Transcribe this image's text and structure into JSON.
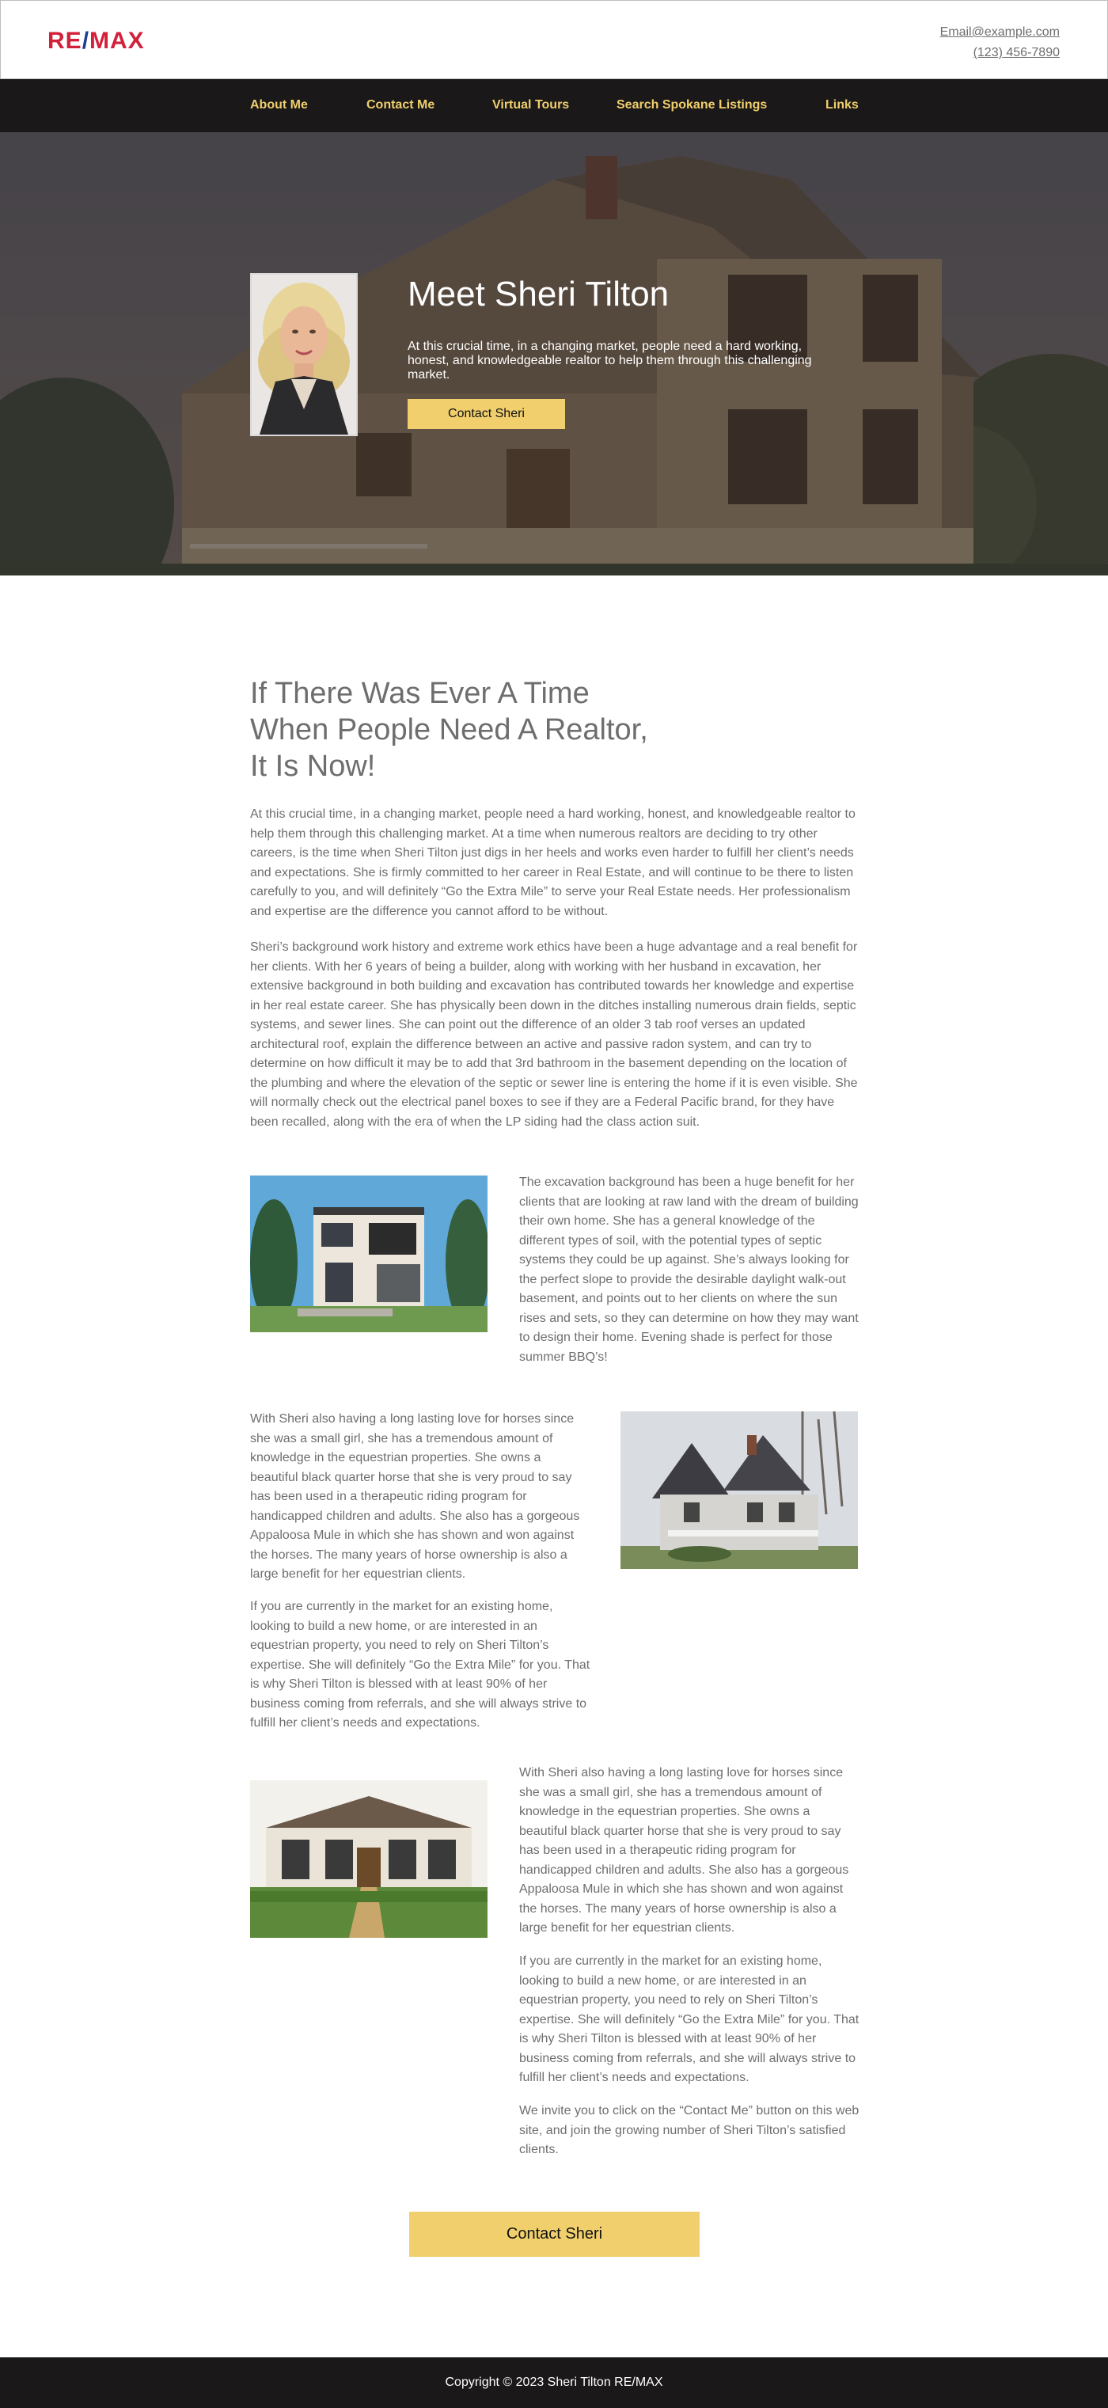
{
  "header": {
    "logo": {
      "re": "RE",
      "slash": "/",
      "max": "MAX"
    },
    "email": "Email@example.com",
    "phone": "(123) 456-7890"
  },
  "nav": {
    "items": [
      "About Me",
      "Contact Me",
      "Virtual Tours",
      "Search Spokane Listings",
      "Links"
    ]
  },
  "hero": {
    "title": "Meet Sheri Tilton",
    "text": "At this crucial time, in a changing market, people need a hard working, honest, and knowledgeable realtor to help them through this challenging market.",
    "button": "Contact Sheri"
  },
  "main": {
    "headline": [
      "If There Was Ever A Time",
      "When People Need A Realtor,",
      "It Is Now!"
    ],
    "intro1": "At this crucial time, in a changing market, people need a hard working, honest, and knowledgeable realtor to help them through this challenging market.  At a time when numerous realtors are deciding to try other careers, is the time when Sheri Tilton just digs in her heels and works even harder to fulfill her client’s needs and expectations.  She is firmly committed to her career in Real Estate, and will continue to be there to listen carefully to you, and will definitely “Go the Extra Mile” to serve your Real Estate needs.  Her professionalism and expertise are the difference you cannot afford to be without.",
    "intro2": "Sheri’s background work history and extreme work ethics have been a huge advantage and a real benefit for her clients.  With her 6 years of being a builder, along with working with her husband in excavation, her extensive background in both building and excavation has contributed towards her knowledge and expertise in her real estate career.  She has physically been down in the ditches installing numerous drain fields, septic systems, and sewer lines.  She can point out the difference of an older 3 tab roof verses an updated architectural roof, explain the difference between an active and passive radon system, and can try to determine on how difficult it may be to add that 3rd bathroom in the basement depending on the location of the plumbing and where the elevation of the septic or sewer line is entering the home if it is even visible.  She  will normally  check out the electrical panel boxes to see if they are a Federal Pacific brand, for they have been recalled, along with the era of when the LP siding had the class action suit.",
    "section1": "The excavation background has been a huge benefit for her clients that are looking at raw land with the dream of building their own home.  She has a general knowledge of the different types of soil, with the potential types of septic systems they could be up against.  She’s always looking for the perfect slope to provide the desirable daylight walk-out basement, and points out to her clients on where the sun rises and sets, so they can determine on how they may want to design their home.  Evening shade is perfect for those summer BBQ’s!",
    "section2a": "With Sheri also having a long lasting love for horses since she was a small girl, she has a tremendous amount of knowledge in the equestrian properties.  She owns a beautiful black quarter horse that she is very proud to say has been used in a therapeutic riding program for handicapped children and adults.  She also has a gorgeous Appaloosa Mule in which she has shown and won against the horses.  The many years of horse ownership is also a large benefit for her equestrian clients.",
    "section2b": "If you are currently in the market for an existing home, looking to build a new home, or are interested in an equestrian property, you need to rely on Sheri Tilton’s expertise.  She will definitely “Go the Extra Mile” for you.  That is why Sheri Tilton is blessed with at least 90% of her business coming from referrals, and she will always strive to fulfill her client’s needs and expectations.",
    "section3a": "With Sheri also having a long lasting love for horses since she was a small girl, she has a tremendous amount of knowledge in the equestrian properties.  She owns a beautiful black quarter horse that she is very proud to say has been used in a therapeutic riding program for handicapped children and adults.  She also has a gorgeous Appaloosa Mule in which she has shown and won against the horses.  The many years of horse ownership is also a large benefit for her equestrian clients.",
    "section3b": "If you are currently in the market for an existing home, looking to build a new home, or are interested in an equestrian property, you need to rely on Sheri Tilton’s expertise.  She will definitely “Go the Extra Mile” for you.  That is why Sheri Tilton is blessed with at least 90% of her business coming from referrals, and she will always strive to fulfill her client’s needs and expectations.",
    "section3c": "We invite you to click on the “Contact Me” button on this web site, and join the growing number of Sheri Tilton’s satisfied clients.",
    "cta": "Contact Sheri"
  },
  "footer": {
    "copyright": "Copyright © 2023 Sheri Tilton RE/MAX"
  },
  "colors": {
    "accent": "#f0cf6c",
    "nav_bg": "#1a1818",
    "logo_red": "#d3203a",
    "logo_blue": "#1d3f8f",
    "text": "#6e6e6e"
  }
}
